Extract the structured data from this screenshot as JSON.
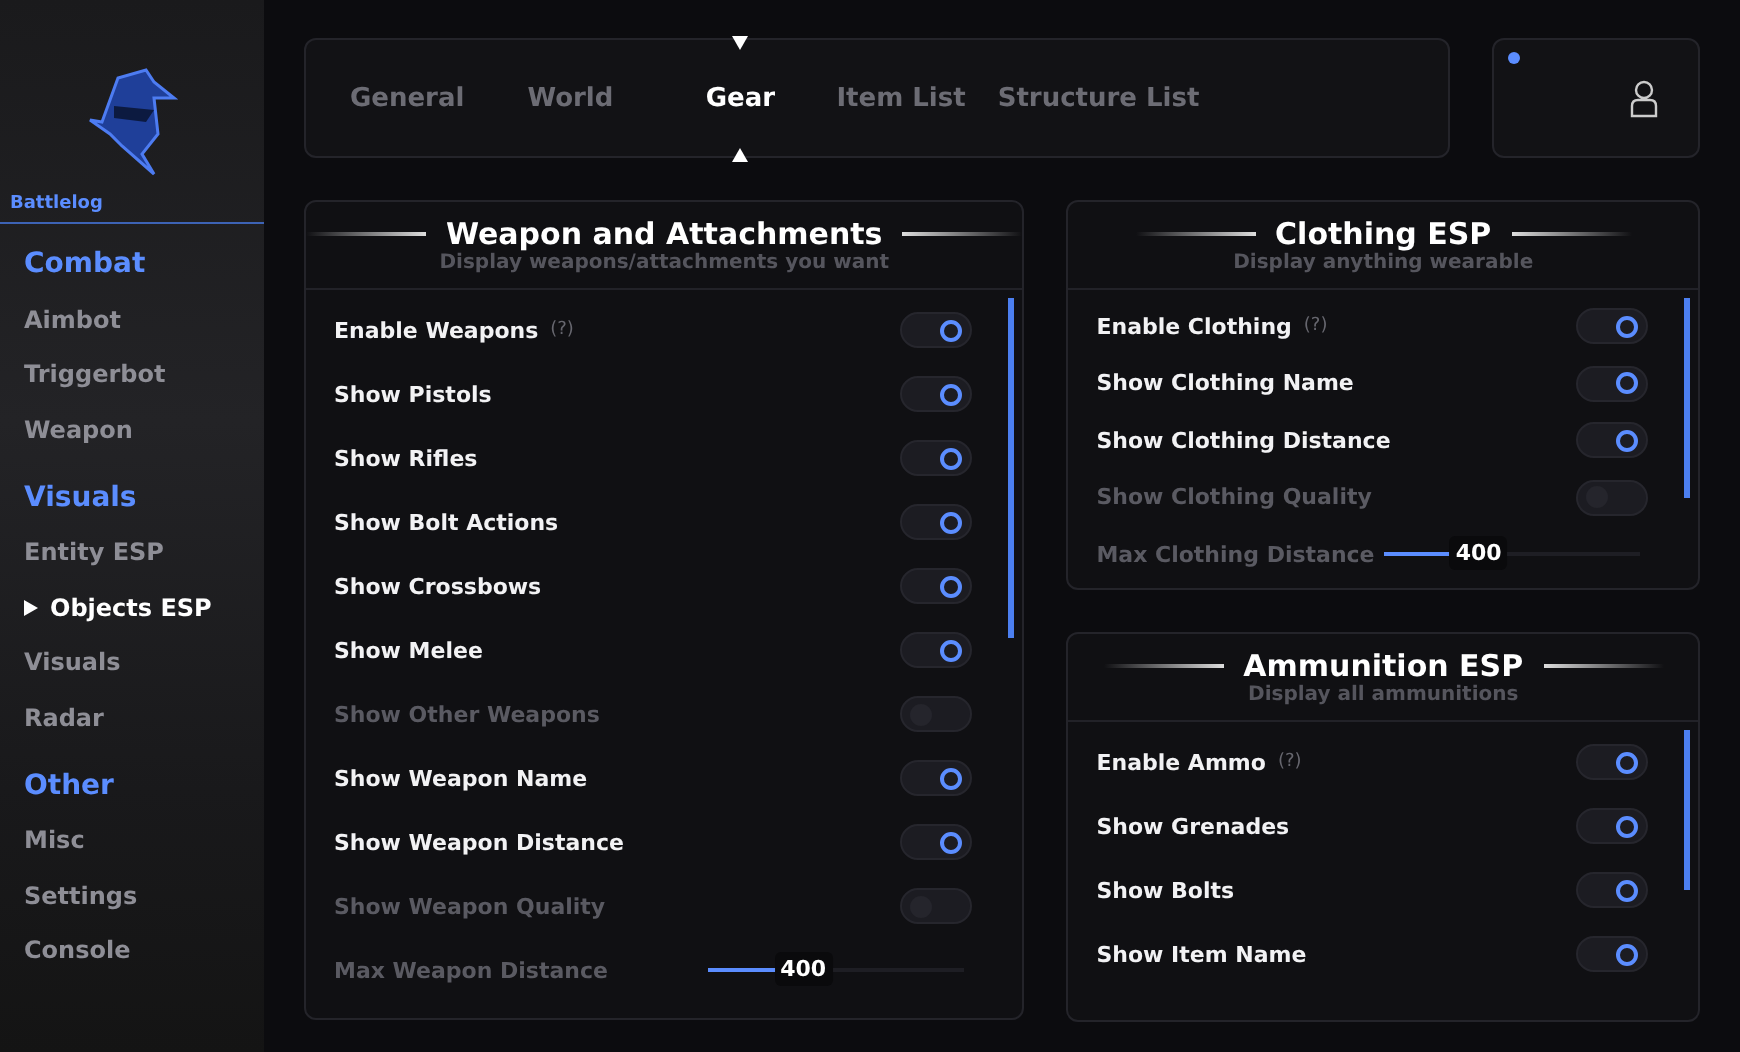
{
  "sidebar": {
    "brand": "Battlelog",
    "sections": [
      {
        "title": "Combat",
        "items": [
          {
            "label": "Aimbot",
            "selected": false
          },
          {
            "label": "Triggerbot",
            "selected": false
          },
          {
            "label": "Weapon",
            "selected": false
          }
        ]
      },
      {
        "title": "Visuals",
        "items": [
          {
            "label": "Entity ESP",
            "selected": false
          },
          {
            "label": "Objects ESP",
            "selected": true
          },
          {
            "label": "Visuals",
            "selected": false
          },
          {
            "label": "Radar",
            "selected": false
          }
        ]
      },
      {
        "title": "Other",
        "items": [
          {
            "label": "Misc",
            "selected": false
          },
          {
            "label": "Settings",
            "selected": false
          },
          {
            "label": "Console",
            "selected": false
          }
        ]
      }
    ]
  },
  "tabs": [
    {
      "label": "General",
      "selected": false
    },
    {
      "label": "World",
      "selected": false
    },
    {
      "label": "Gear",
      "selected": true
    },
    {
      "label": "Item List",
      "selected": false
    },
    {
      "label": "Structure List",
      "selected": false
    }
  ],
  "profile": {
    "online": true
  },
  "panels": [
    {
      "title": "Weapon and Attachments",
      "subtitle": "Display weapons/attachments you want",
      "rows": [
        {
          "kind": "toggle",
          "label": "Enable Weapons",
          "hint": "(?)",
          "on": true
        },
        {
          "kind": "toggle",
          "label": "Show Pistols",
          "on": true
        },
        {
          "kind": "toggle",
          "label": "Show Rifles",
          "on": true
        },
        {
          "kind": "toggle",
          "label": "Show Bolt Actions",
          "on": true
        },
        {
          "kind": "toggle",
          "label": "Show Crossbows",
          "on": true
        },
        {
          "kind": "toggle",
          "label": "Show Melee",
          "on": true
        },
        {
          "kind": "toggle",
          "label": "Show Other Weapons",
          "on": false
        },
        {
          "kind": "toggle",
          "label": "Show Weapon Name",
          "on": true
        },
        {
          "kind": "toggle",
          "label": "Show Weapon Distance",
          "on": true
        },
        {
          "kind": "toggle",
          "label": "Show Weapon Quality",
          "on": false
        },
        {
          "kind": "slider",
          "label": "Max Weapon Distance",
          "value": "400",
          "level": 0.37
        }
      ]
    },
    {
      "title": "Clothing ESP",
      "subtitle": "Display anything wearable",
      "rows": [
        {
          "kind": "toggle",
          "label": "Enable Clothing",
          "hint": "(?)",
          "on": true
        },
        {
          "kind": "toggle",
          "label": "Show Clothing Name",
          "on": true
        },
        {
          "kind": "toggle",
          "label": "Show Clothing Distance",
          "on": true
        },
        {
          "kind": "toggle",
          "label": "Show Clothing Quality",
          "on": false
        },
        {
          "kind": "slider",
          "label": "Max Clothing Distance",
          "value": "400",
          "level": 0.37
        }
      ]
    },
    {
      "title": "Ammunition ESP",
      "subtitle": "Display all ammunitions",
      "rows": [
        {
          "kind": "toggle",
          "label": "Enable Ammo",
          "hint": "(?)",
          "on": true
        },
        {
          "kind": "toggle",
          "label": "Show Grenades",
          "on": true
        },
        {
          "kind": "toggle",
          "label": "Show Bolts",
          "on": true
        },
        {
          "kind": "toggle",
          "label": "Show Item Name",
          "on": true
        }
      ]
    }
  ]
}
